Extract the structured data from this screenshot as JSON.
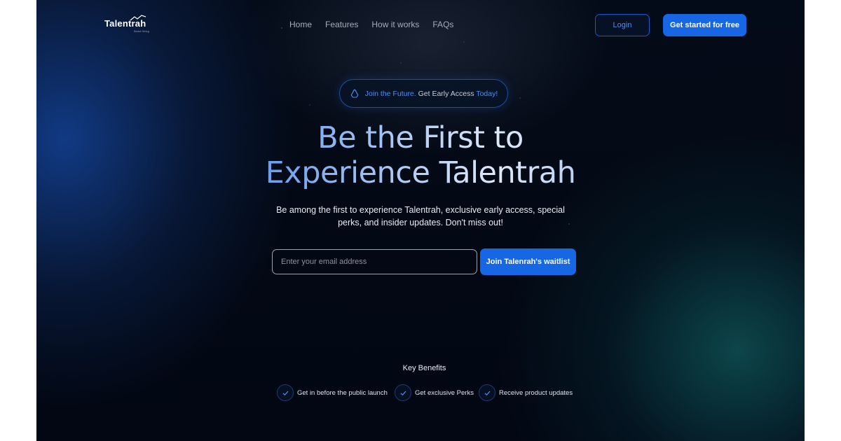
{
  "brand": {
    "name": "Talentrah",
    "tagline": "Smart Hiring"
  },
  "nav": {
    "items": [
      "Home",
      "Features",
      "How it works",
      "FAQs"
    ]
  },
  "header": {
    "login_label": "Login",
    "cta_label": "Get started for free"
  },
  "badge": {
    "icon": "recycle-icon",
    "part1": "Join the Future.",
    "part2": "Get Early Access",
    "part3": "Today!"
  },
  "hero": {
    "title_line1": "Be the First to",
    "title_line2": "Experience Talentrah",
    "subtitle": "Be among the first to experience Talentrah, exclusive early access, special perks, and insider updates. Don't miss out!"
  },
  "waitlist": {
    "placeholder": "Enter your email address",
    "value": "",
    "button_label": "Join Talenrah's waitlist"
  },
  "benefits": {
    "title": "Key Benefits",
    "items": [
      "Get in before the public launch",
      "Get exclusive Perks",
      "Receive product updates"
    ]
  },
  "colors": {
    "accent": "#1766e4",
    "accent_text": "#4e8df2",
    "background": "#030914"
  }
}
